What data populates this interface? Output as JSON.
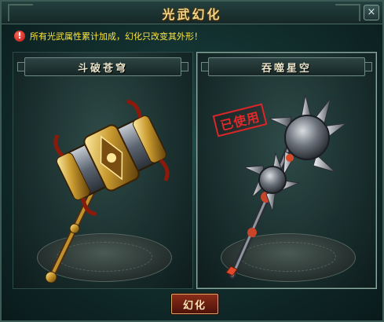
{
  "window": {
    "title": "光武幻化",
    "close_label": "×"
  },
  "notice": {
    "icon": "exclamation-icon",
    "icon_glyph": "!",
    "text": "所有光武属性累计加成，幻化只改变其外形！"
  },
  "panels": [
    {
      "name": "斗破苍穹",
      "weapon": "war-hammer",
      "in_use": false
    },
    {
      "name": "吞噬星空",
      "weapon": "spiked-mace",
      "in_use": true,
      "in_use_label": "已使用"
    }
  ],
  "actions": {
    "transform_label": "幻化"
  },
  "colors": {
    "title": "#f0d58a",
    "notice_text": "#ffe640",
    "stamp": "#e02a2a",
    "button_bg": "#8a2d18"
  }
}
